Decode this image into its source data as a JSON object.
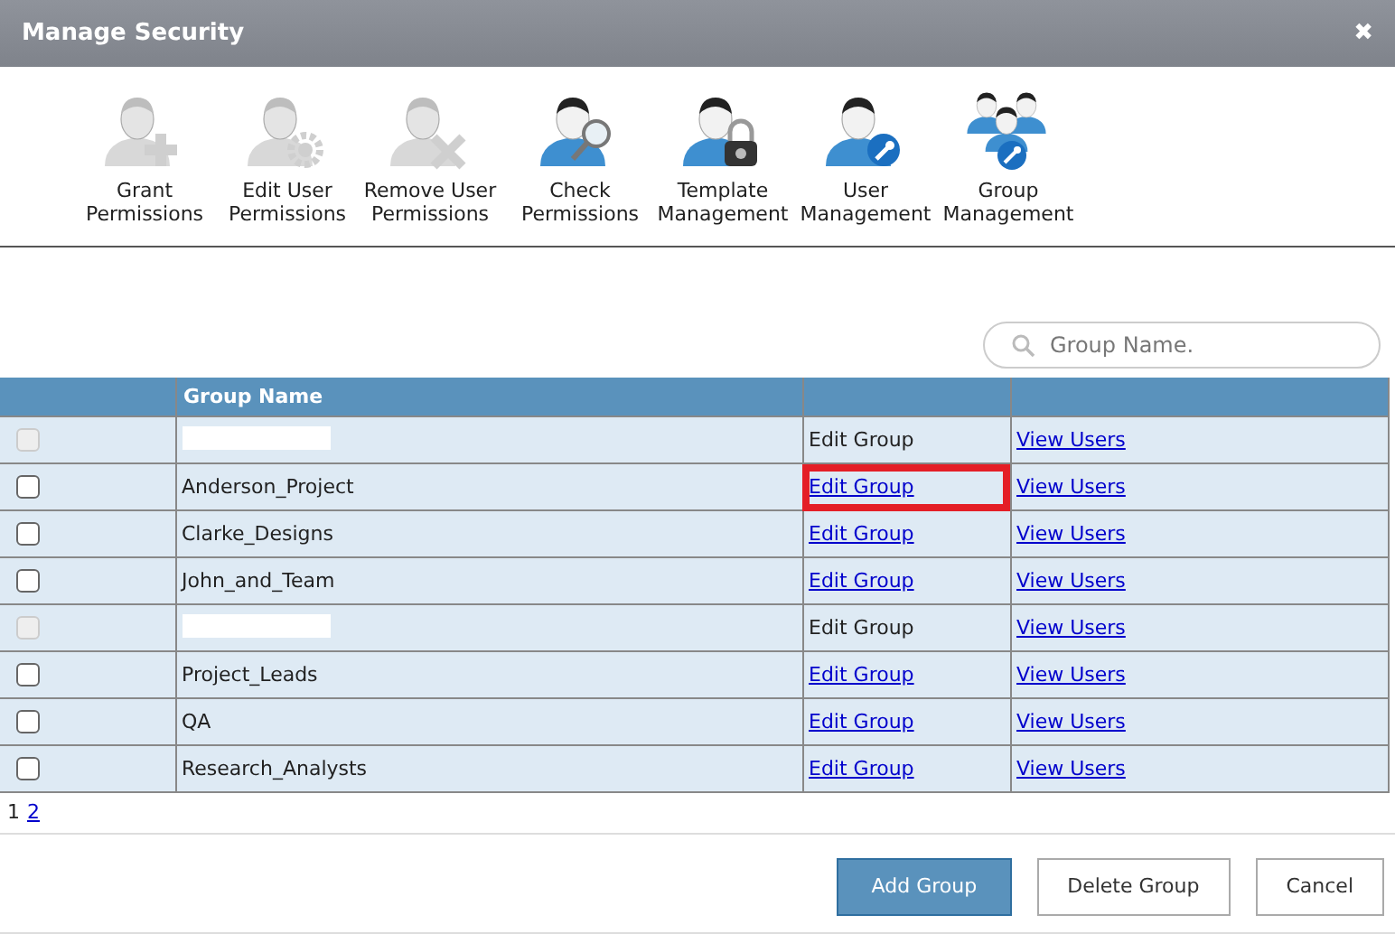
{
  "window": {
    "title": "Manage Security",
    "close": "✖"
  },
  "toolbar": [
    {
      "kind": "plus",
      "label": "Grant Permissions",
      "disabled": true
    },
    {
      "kind": "gear",
      "label": "Edit User Permissions",
      "disabled": true
    },
    {
      "kind": "remove",
      "label": "Remove User Permissions",
      "disabled": true
    },
    {
      "kind": "search",
      "label": "Check Permissions",
      "disabled": false
    },
    {
      "kind": "lock",
      "label": "Template Management",
      "disabled": false
    },
    {
      "kind": "wrench",
      "label": "User Management",
      "disabled": false
    },
    {
      "kind": "group",
      "label": "Group Management",
      "disabled": false
    }
  ],
  "search": {
    "placeholder": "Group Name."
  },
  "table": {
    "columns": [
      "Group Name"
    ],
    "rows": [
      {
        "name": "",
        "redacted": true,
        "disabled": true,
        "checked": false,
        "edit": "Edit Group",
        "view": "View Users",
        "highlighted": false
      },
      {
        "name": "Anderson_Project",
        "redacted": false,
        "disabled": false,
        "checked": false,
        "edit": "Edit Group",
        "view": "View Users",
        "highlighted": true
      },
      {
        "name": "Clarke_Designs",
        "redacted": false,
        "disabled": false,
        "checked": false,
        "edit": "Edit Group",
        "view": "View Users",
        "highlighted": false
      },
      {
        "name": "John_and_Team",
        "redacted": false,
        "disabled": false,
        "checked": false,
        "edit": "Edit Group",
        "view": "View Users",
        "highlighted": false
      },
      {
        "name": "",
        "redacted": true,
        "disabled": true,
        "checked": false,
        "edit": "Edit Group",
        "view": "View Users",
        "highlighted": false
      },
      {
        "name": "Project_Leads",
        "redacted": false,
        "disabled": false,
        "checked": false,
        "edit": "Edit Group",
        "view": "View Users",
        "highlighted": false
      },
      {
        "name": "QA",
        "redacted": false,
        "disabled": false,
        "checked": false,
        "edit": "Edit Group",
        "view": "View Users",
        "highlighted": false
      },
      {
        "name": "Research_Analysts",
        "redacted": false,
        "disabled": false,
        "checked": false,
        "edit": "Edit Group",
        "view": "View Users",
        "highlighted": false
      }
    ]
  },
  "pagination": [
    {
      "label": "1",
      "selected": true
    },
    {
      "label": "2",
      "selected": false
    }
  ],
  "buttons": [
    {
      "label": "Add Group",
      "kind": "primary"
    },
    {
      "label": "Delete Group",
      "kind": "default"
    },
    {
      "label": "Cancel",
      "kind": "default"
    }
  ]
}
